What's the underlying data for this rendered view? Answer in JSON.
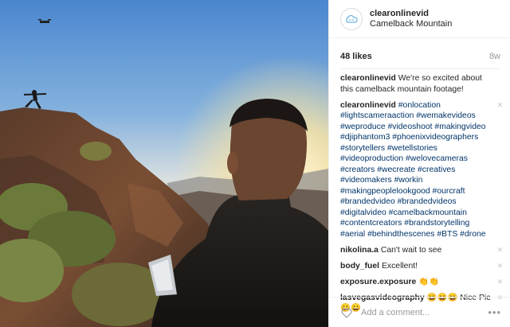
{
  "header": {
    "username": "clearonlinevid",
    "location": "Camelback Mountain"
  },
  "stats": {
    "likes": "48 likes",
    "age": "8w"
  },
  "caption": {
    "user": "clearonlinevid",
    "text": "We're so excited about this camelback mountain footage!"
  },
  "hashtag_comment": {
    "user": "clearonlinevid",
    "tags": "#onlocation #lightscameraaction #wemakevideos #weproduce #videoshoot #makingvideo #djiphantom3 #phoenixvideographers #storytellers #wetellstories #videoproduction #welovecameras #creators #wecreate #creatives #videomakers #workin #makingpeoplelookgood #ourcraft #brandedvideo #brandedvideos #digitalvideo #camelbackmountain #contentcreators #brandstorytelling #aerial #behindthescenes #BTS #drone"
  },
  "comments": [
    {
      "user": "nikolina.a",
      "text": "Can't wait to see"
    },
    {
      "user": "body_fuel",
      "text": "Excellent!"
    },
    {
      "user": "exposure.exposure",
      "text": "👏👏"
    },
    {
      "user": "lasvegasvideography",
      "text": "😀😀😀 Nice Pic 😀😀"
    }
  ],
  "add_comment": {
    "placeholder": "Add a comment..."
  },
  "icons": {
    "avatar": "cloud-logo-icon",
    "heart": "heart-icon",
    "more": "more-options-icon",
    "delete": "close-icon"
  },
  "colors": {
    "hashtag": "#003569",
    "muted": "#999999",
    "border": "#efefef"
  }
}
